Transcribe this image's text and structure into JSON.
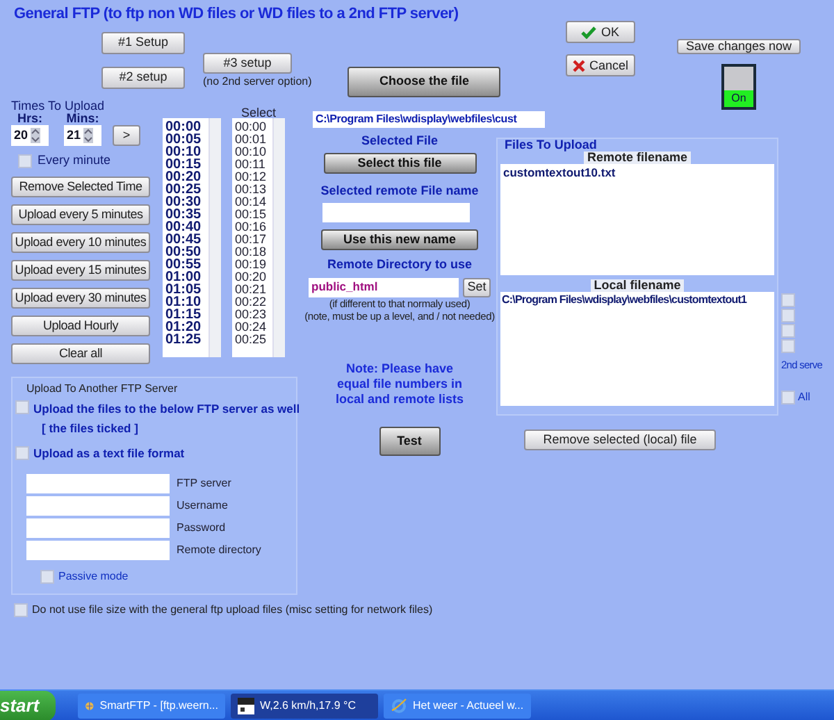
{
  "title": "General FTP (to ftp non WD files or WD files to a 2nd FTP server)",
  "setup_buttons": [
    {
      "label": "#1 Setup"
    },
    {
      "label": "#2 setup"
    },
    {
      "label": "#3 setup",
      "note": "(no 2nd server option)"
    }
  ],
  "choose_file_button": "Choose the file",
  "ok_button": "OK",
  "cancel_button": "Cancel",
  "save_button": "Save changes now",
  "toggle": {
    "label": "On",
    "on": true
  },
  "times": {
    "label": "Times To Upload",
    "hrs_label": "Hrs:",
    "hrs": "20",
    "mins_label": "Mins:",
    "mins": "21",
    "add_button": ">",
    "every_minute": {
      "label": "Every minute",
      "checked": false
    },
    "buttons": [
      "Remove Selected Time",
      "Upload every 5 minutes",
      "Upload every 10 minutes",
      "Upload every 15 minutes",
      "Upload every 30 minutes",
      "Upload Hourly",
      "Clear all"
    ],
    "scheduled": [
      "00:00",
      "00:05",
      "00:10",
      "00:15",
      "00:20",
      "00:25",
      "00:30",
      "00:35",
      "00:40",
      "00:45",
      "00:50",
      "00:55",
      "01:00",
      "01:05",
      "01:10",
      "01:15",
      "01:20",
      "01:25"
    ],
    "select_label": "Select",
    "select_list": [
      "00:00",
      "00:01",
      "00:10",
      "00:11",
      "00:12",
      "00:13",
      "00:14",
      "00:15",
      "00:16",
      "00:17",
      "00:18",
      "00:19",
      "00:20",
      "00:21",
      "00:22",
      "00:23",
      "00:24",
      "00:25"
    ]
  },
  "file_path": "C:\\Program Files\\wdisplay\\webfiles\\cust",
  "selected_file_label": "Selected File",
  "select_file_button": "Select this file",
  "remote_name_label": "Selected remote File name",
  "use_name_button": "Use this new name",
  "remote_dir_label": "Remote Directory to use",
  "remote_dir": "public_html",
  "set_button": "Set",
  "remote_dir_notes": [
    "(if different to that normaly used)",
    "(note, must be up a level, and / not needed)"
  ],
  "equal_note": "Note: Please have equal file numbers in local and remote lists",
  "test_button": "Test",
  "files": {
    "label": "Files To Upload",
    "remote_header": "Remote filename",
    "remote": [
      "customtextout10.txt"
    ],
    "local_header": "Local filename",
    "local": [
      "C:\\Program Files\\wdisplay\\webfiles\\customtextout1"
    ]
  },
  "server_checks": [
    {
      "checked": false
    },
    {
      "checked": false
    },
    {
      "checked": false
    },
    {
      "checked": false
    }
  ],
  "second_server_label": "2nd serve",
  "all_check": {
    "label": "All",
    "checked": false
  },
  "remove_button": "Remove selected (local) file",
  "ftp": {
    "label": "Upload To Another FTP Server",
    "upload_check": {
      "label": "Upload the files to the below FTP server as well",
      "sub": "[ the files ticked ]",
      "checked": false
    },
    "text_check": {
      "label": "Upload as a text file format",
      "checked": false
    },
    "fields": [
      {
        "label": "FTP server"
      },
      {
        "label": "Username"
      },
      {
        "label": "Password"
      },
      {
        "label": "Remote directory"
      }
    ],
    "passive": {
      "label": "Passive mode",
      "checked": false
    }
  },
  "file_size_check": {
    "label": "Do not use file size with the general ftp upload files (misc setting for network files)",
    "checked": false
  },
  "taskbar": {
    "start": "start",
    "tasks": [
      {
        "label": "SmartFTP - [ftp.weern...",
        "kind": "globe",
        "selected": false
      },
      {
        "label": "W,2.6 km/h,17.9 °C",
        "kind": "weather",
        "selected": true
      },
      {
        "label": "Het weer - Actueel w...",
        "kind": "browser",
        "selected": false
      }
    ]
  }
}
